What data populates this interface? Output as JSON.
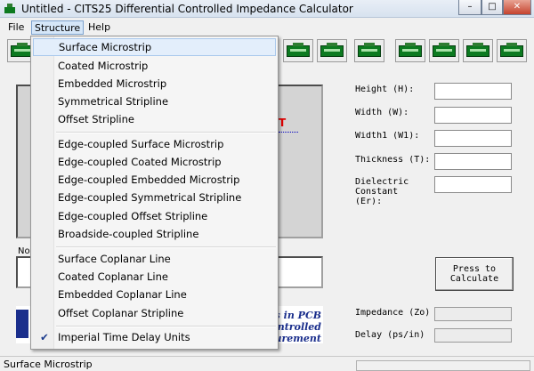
{
  "window": {
    "title": "Untitled - CITS25 Differential Controlled Impedance Calculator",
    "minimize": "–",
    "maximize": "□",
    "close": "✕"
  },
  "menubar": {
    "file": "File",
    "structure": "Structure",
    "help": "Help"
  },
  "toolbar": {
    "button_count": 15,
    "icon": "pcb-stackup-icon"
  },
  "structure_menu": {
    "group1": [
      "Surface Microstrip",
      "Coated Microstrip",
      "Embedded Microstrip",
      "Symmetrical Stripline",
      "Offset Stripline"
    ],
    "group2": [
      "Edge-coupled Surface Microstrip",
      "Edge-coupled Coated Microstrip",
      "Edge-coupled Embedded Microstrip",
      "Edge-coupled Symmetrical Stripline",
      "Edge-coupled Offset Stripline",
      "Broadside-coupled Stripline"
    ],
    "group3": [
      "Surface Coplanar Line",
      "Coated Coplanar Line",
      "Embedded Coplanar Line",
      "Offset Coplanar Stripline"
    ],
    "group4": {
      "label": "Imperial Time Delay Units",
      "checked": true
    }
  },
  "diagram": {
    "fragment_t": "T"
  },
  "notes": {
    "label_fragment": "No"
  },
  "banner": {
    "line1": "ers in PCB",
    "line2": "Controlled",
    "line3": "asurement"
  },
  "inputs": {
    "height_label": "Height (H):",
    "width_label": "Width (W):",
    "width1_label": "Width1 (W1):",
    "thickness_label": "Thickness (T):",
    "dielectric_label1": "Dielectric",
    "dielectric_label2": "Constant",
    "dielectric_label3": "(Er):"
  },
  "calculate_button": {
    "line1": "Press to",
    "line2": "Calculate"
  },
  "outputs": {
    "impedance_label": "Impedance (Zo)",
    "delay_label": "Delay (ps/in)"
  },
  "statusbar": {
    "text": "Surface Microstrip"
  },
  "colors": {
    "menu_highlight": "#e3eefb",
    "pcb_green": "#0c7a20",
    "banner_blue": "#1a2e8c"
  }
}
